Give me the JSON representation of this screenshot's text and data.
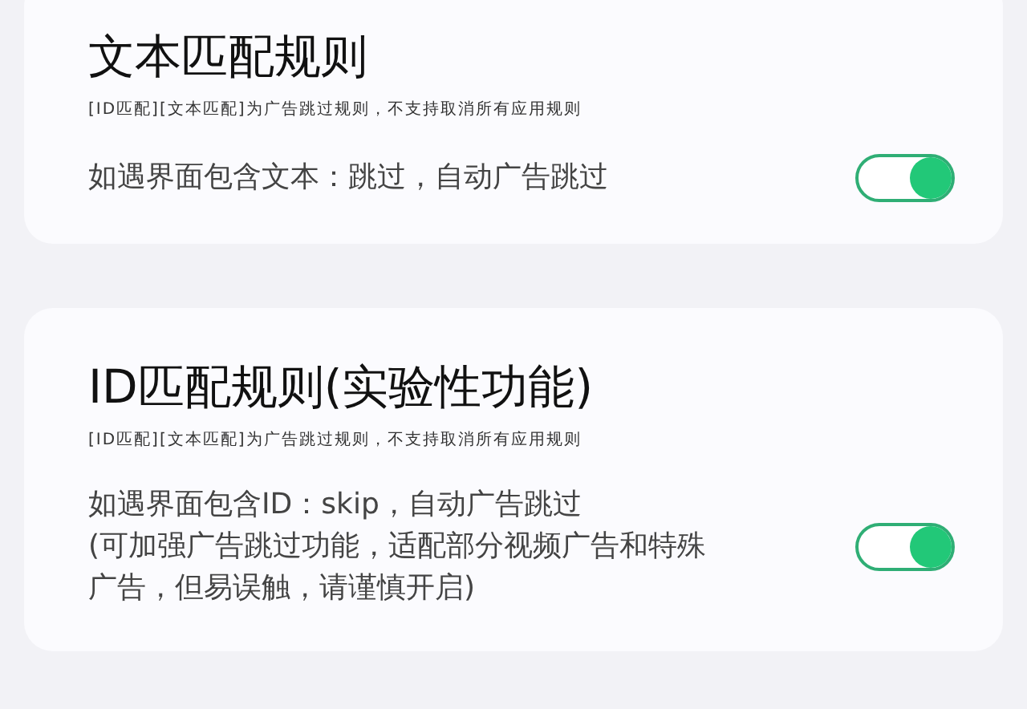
{
  "cards": [
    {
      "title": "文本匹配规则",
      "note": "[ID匹配][文本匹配]为广告跳过规则，不支持取消所有应用规则",
      "description": "如遇界面包含文本：跳过，自动广告跳过",
      "on": true
    },
    {
      "title": "ID匹配规则(实验性功能)",
      "note": "[ID匹配][文本匹配]为广告跳过规则，不支持取消所有应用规则",
      "description": "如遇界面包含ID：skip，自动广告跳过",
      "detail": "(可加强广告跳过功能，适配部分视频广告和特殊广告，但易误触，请谨慎开启)",
      "on": true
    }
  ]
}
